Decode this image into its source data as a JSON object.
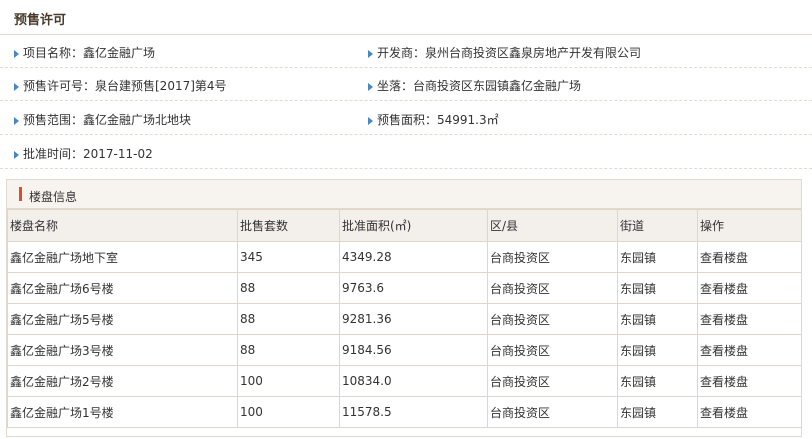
{
  "section_title": "预售许可",
  "info": {
    "project_name": "项目名称：鑫亿金融广场",
    "developer": "开发商：泉州台商投资区鑫泉房地产开发有限公司",
    "permit_no": "预售许可号：泉台建预售[2017]第4号",
    "location": "坐落：台商投资区东园镇鑫亿金融广场",
    "scope": "预售范围：鑫亿金融广场北地块",
    "area": "预售面积：54991.3㎡",
    "approval_time": "批准时间：2017-11-02"
  },
  "panel_title": "楼盘信息",
  "table": {
    "headers": [
      "楼盘名称",
      "批售套数",
      "批准面积(㎡)",
      "区/县",
      "街道",
      "操作"
    ],
    "rows": [
      [
        "鑫亿金融广场地下室",
        "345",
        "4349.28",
        "台商投资区",
        "东园镇",
        "查看楼盘"
      ],
      [
        "鑫亿金融广场6号楼",
        "88",
        "9763.6",
        "台商投资区",
        "东园镇",
        "查看楼盘"
      ],
      [
        "鑫亿金融广场5号楼",
        "88",
        "9281.36",
        "台商投资区",
        "东园镇",
        "查看楼盘"
      ],
      [
        "鑫亿金融广场3号楼",
        "88",
        "9184.56",
        "台商投资区",
        "东园镇",
        "查看楼盘"
      ],
      [
        "鑫亿金融广场2号楼",
        "100",
        "10834.0",
        "台商投资区",
        "东园镇",
        "查看楼盘"
      ],
      [
        "鑫亿金融广场1号楼",
        "100",
        "11578.5",
        "台商投资区",
        "东园镇",
        "查看楼盘"
      ]
    ]
  },
  "colors": {
    "accent_bar": "#d9502b",
    "arrow": "#4a86c6",
    "header_bg": "#f3f0ec"
  }
}
